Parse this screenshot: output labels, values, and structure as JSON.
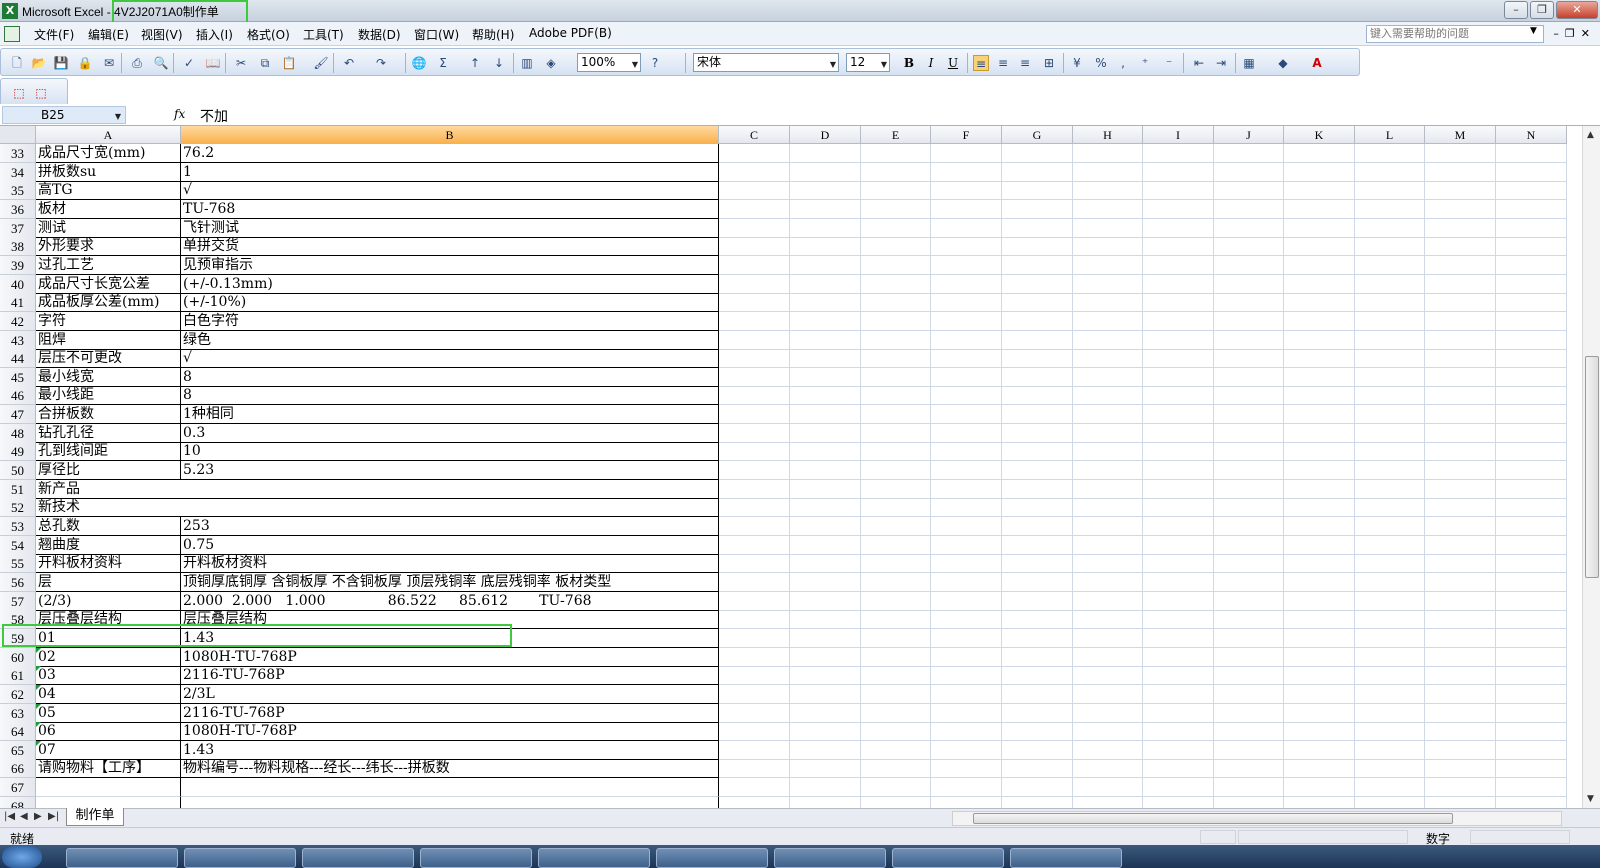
{
  "window": {
    "app_name": "Microsoft Excel",
    "doc_title": "- 4V2J2071A0制作单"
  },
  "menu": {
    "items": [
      "文件(F)",
      "编辑(E)",
      "视图(V)",
      "插入(I)",
      "格式(O)",
      "工具(T)",
      "数据(D)",
      "窗口(W)",
      "帮助(H)",
      "Adobe PDF(B)"
    ],
    "help_placeholder": "键入需要帮助的问题"
  },
  "toolbar": {
    "zoom": "100%",
    "font": "宋体",
    "font_size": "12",
    "bold": "B",
    "italic": "I",
    "underline": "U"
  },
  "formula_bar": {
    "cell_ref": "B25",
    "fx": "fx",
    "content": "不加"
  },
  "columns": [
    "A",
    "B",
    "C",
    "D",
    "E",
    "F",
    "G",
    "H",
    "I",
    "J",
    "K",
    "L",
    "M",
    "N"
  ],
  "selected_column": "B",
  "rows": [
    {
      "n": "33",
      "a": "成品尺寸宽(mm)",
      "b": "76.2"
    },
    {
      "n": "34",
      "a": "拼板数su",
      "b": "1"
    },
    {
      "n": "35",
      "a": "高TG",
      "b": "√"
    },
    {
      "n": "36",
      "a": "板材",
      "b": "TU-768"
    },
    {
      "n": "37",
      "a": "测试",
      "b": "飞针测试"
    },
    {
      "n": "38",
      "a": "外形要求",
      "b": "单拼交货"
    },
    {
      "n": "39",
      "a": "过孔工艺",
      "b": "见预审指示"
    },
    {
      "n": "40",
      "a": "成品尺寸长宽公差",
      "b": "(+/-0.13mm)"
    },
    {
      "n": "41",
      "a": "成品板厚公差(mm)",
      "b": "(+/-10%)"
    },
    {
      "n": "42",
      "a": "字符",
      "b": "白色字符"
    },
    {
      "n": "43",
      "a": "阻焊",
      "b": "绿色"
    },
    {
      "n": "44",
      "a": "层压不可更改",
      "b": "√"
    },
    {
      "n": "45",
      "a": "最小线宽",
      "b": "8"
    },
    {
      "n": "46",
      "a": "最小线距",
      "b": "8"
    },
    {
      "n": "47",
      "a": "合拼板数",
      "b": "1种相同"
    },
    {
      "n": "48",
      "a": "钻孔孔径",
      "b": "0.3"
    },
    {
      "n": "49",
      "a": "孔到线间距",
      "b": "10"
    },
    {
      "n": "50",
      "a": "厚径比",
      "b": "5.23"
    },
    {
      "n": "51",
      "a": "新产品",
      "b": ""
    },
    {
      "n": "52",
      "a": "新技术",
      "b": ""
    },
    {
      "n": "53",
      "a": "总孔数",
      "b": "253"
    },
    {
      "n": "54",
      "a": "翘曲度",
      "b": "0.75"
    },
    {
      "n": "55",
      "a": "开料板材资料",
      "b": "开料板材资料"
    },
    {
      "n": "56",
      "a": "层",
      "b": "顶铜厚底铜厚 含铜板厚 不含铜板厚 顶层残铜率 底层残铜率 板材类型"
    },
    {
      "n": "57",
      "a": "(2/3)",
      "b": "2.000  2.000   1.000              86.522     85.612       TU-768"
    },
    {
      "n": "58",
      "a": "层压叠层结构",
      "b": "层压叠层结构"
    },
    {
      "n": "59",
      "a": "01",
      "b": "1.43"
    },
    {
      "n": "60",
      "a": "02",
      "b": "1080H-TU-768P"
    },
    {
      "n": "61",
      "a": "03",
      "b": "2116-TU-768P"
    },
    {
      "n": "62",
      "a": "04",
      "b": "2/3L"
    },
    {
      "n": "63",
      "a": "05",
      "b": "2116-TU-768P"
    },
    {
      "n": "64",
      "a": "06",
      "b": "1080H-TU-768P"
    },
    {
      "n": "65",
      "a": "07",
      "b": "1.43"
    },
    {
      "n": "66",
      "a": "请购物料【工序】",
      "b": "物料编号---物料规格---经长---纬长---拼板数"
    },
    {
      "n": "67",
      "a": "",
      "b": ""
    },
    {
      "n": "68",
      "a": "",
      "b": ""
    }
  ],
  "sheet_tab": "制作单",
  "status": {
    "ready": "就绪",
    "mode": "数字"
  }
}
